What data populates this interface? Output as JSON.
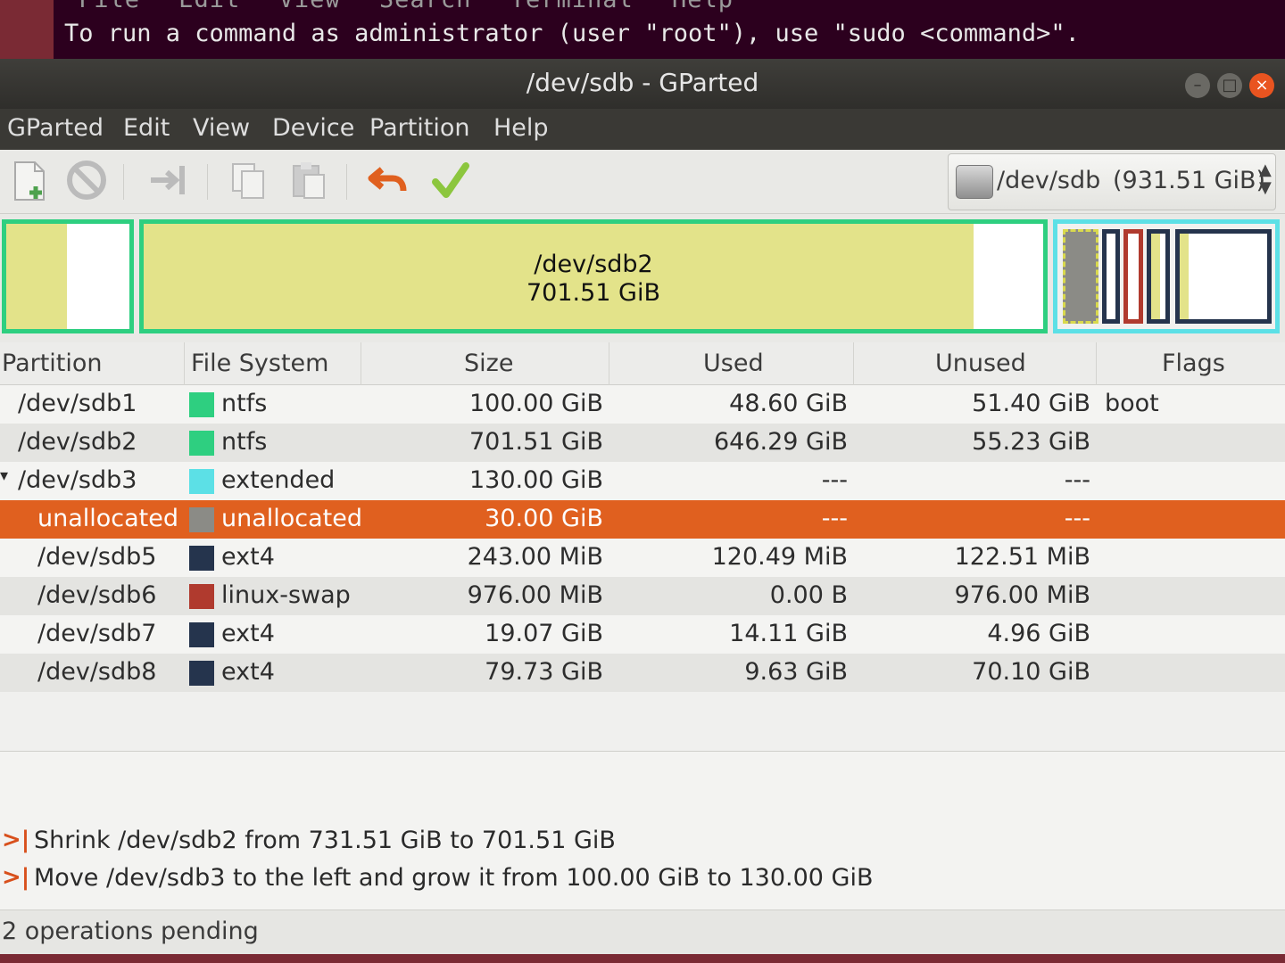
{
  "terminal": {
    "menu": [
      "File",
      "Edit",
      "View",
      "Search",
      "Terminal",
      "Help"
    ],
    "line": "To run a command as administrator (user \"root\"), use \"sudo <command>\"."
  },
  "window": {
    "title": "/dev/sdb - GParted"
  },
  "menubar": [
    "GParted",
    "Edit",
    "View",
    "Device",
    "Partition",
    "Help"
  ],
  "toolbar": {
    "icons": [
      "new-partition-icon",
      "delete-icon",
      "resize-move-icon",
      "copy-icon",
      "paste-icon",
      "undo-icon",
      "apply-icon"
    ],
    "device": {
      "name": "/dev/sdb",
      "size": "(931.51 GiB)"
    }
  },
  "diskmap": {
    "main_label": "/dev/sdb2",
    "main_size": "701.51 GiB"
  },
  "table": {
    "headers": [
      "Partition",
      "File System",
      "Size",
      "Used",
      "Unused",
      "Flags"
    ],
    "rows": [
      {
        "partition": "/dev/sdb1",
        "fs": "ntfs",
        "color": "#2ecf80",
        "size": "100.00 GiB",
        "used": "48.60 GiB",
        "unused": "51.40 GiB",
        "flags": "boot"
      },
      {
        "partition": "/dev/sdb2",
        "fs": "ntfs",
        "color": "#2ecf80",
        "size": "701.51 GiB",
        "used": "646.29 GiB",
        "unused": "55.23 GiB",
        "flags": ""
      },
      {
        "partition": "/dev/sdb3",
        "fs": "extended",
        "color": "#5ce0e6",
        "size": "130.00 GiB",
        "used": "---",
        "unused": "---",
        "flags": ""
      },
      {
        "partition": "unallocated",
        "fs": "unallocated",
        "color": "#8b8b86",
        "size": "30.00 GiB",
        "used": "---",
        "unused": "---",
        "flags": ""
      },
      {
        "partition": "/dev/sdb5",
        "fs": "ext4",
        "color": "#25344d",
        "size": "243.00 MiB",
        "used": "120.49 MiB",
        "unused": "122.51 MiB",
        "flags": ""
      },
      {
        "partition": "/dev/sdb6",
        "fs": "linux-swap",
        "color": "#b03a2e",
        "size": "976.00 MiB",
        "used": "0.00 B",
        "unused": "976.00 MiB",
        "flags": ""
      },
      {
        "partition": "/dev/sdb7",
        "fs": "ext4",
        "color": "#25344d",
        "size": "19.07 GiB",
        "used": "14.11 GiB",
        "unused": "4.96 GiB",
        "flags": ""
      },
      {
        "partition": "/dev/sdb8",
        "fs": "ext4",
        "color": "#25344d",
        "size": "79.73 GiB",
        "used": "9.63 GiB",
        "unused": "70.10 GiB",
        "flags": ""
      }
    ]
  },
  "operations": [
    "Shrink /dev/sdb2 from 731.51 GiB to 701.51 GiB",
    "Move /dev/sdb3 to the left and grow it from 100.00 GiB to 130.00 GiB"
  ],
  "status": "2 operations pending",
  "colors": {
    "accent": "#e0601f",
    "ntfs": "#2ecf80",
    "extended": "#5ce0e6",
    "ext4": "#25344d",
    "swap": "#b03a2e",
    "used_fill": "#e3e38a"
  }
}
